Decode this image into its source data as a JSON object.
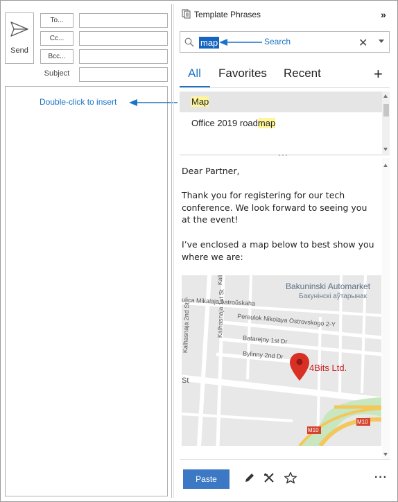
{
  "compose": {
    "send_label": "Send",
    "to_label": "To...",
    "cc_label": "Cc...",
    "bcc_label": "Bcc...",
    "subject_label": "Subject"
  },
  "callouts": {
    "search": "Search",
    "insert": "Double-click to insert"
  },
  "pane": {
    "title": "Template Phrases",
    "search": {
      "value": "map"
    },
    "tabs": [
      {
        "label": "All",
        "active": true
      },
      {
        "label": "Favorites",
        "active": false
      },
      {
        "label": "Recent",
        "active": false
      }
    ],
    "list": [
      {
        "label": "Map",
        "match": "Map",
        "prefix": "",
        "selected": true
      },
      {
        "label": "Office 2019 roadmap",
        "prefix": "Office 2019 road",
        "match": "map",
        "selected": false
      }
    ],
    "preview": {
      "lines": [
        "Dear Partner,",
        "Thank you for registering for our tech conference. We look forward to seeing you at the event!",
        "I’ve enclosed a map below to best show you where we are:"
      ],
      "map": {
        "place": "Bakuninski Automarket",
        "place_local": "Бакунінскі аўтарынак",
        "pin_label": "4Bits Ltd.",
        "streets": [
          "Pereulok Nikolaya Ostrovskogo 2-Y",
          "Batarejny 1st Dr",
          "Bylinny 2nd Dr",
          "Kalhasnaja 2nd St",
          "Kalhasnaja 1st St",
          "ulica Mikalaja Astroŭskaha",
          "St",
          "M10",
          "M10",
          "Kalh"
        ]
      }
    },
    "footer": {
      "paste_label": "Paste"
    }
  },
  "colors": {
    "accent": "#1a73c8",
    "highlight": "#fff59a",
    "paste_bg": "#3c78c4",
    "pin": "#d93025"
  }
}
